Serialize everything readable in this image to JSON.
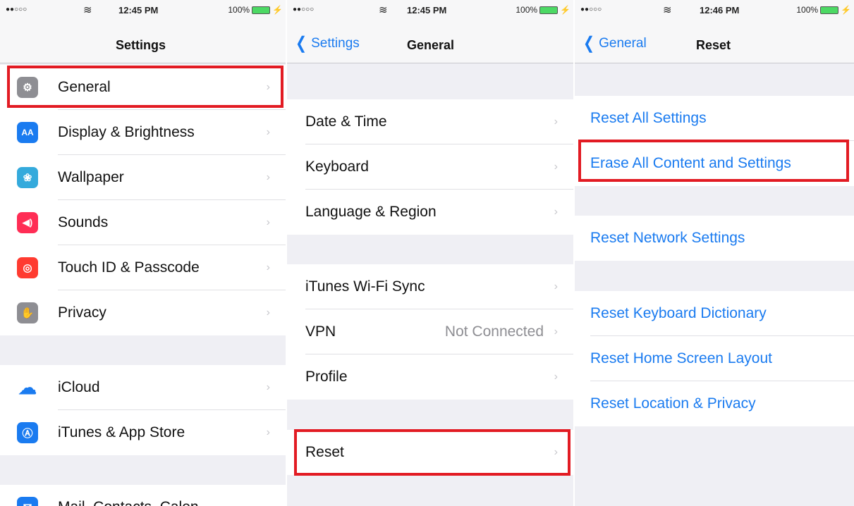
{
  "status_bars": [
    {
      "signal": "●●○○○",
      "time": "12:45 PM",
      "battery": "100%"
    },
    {
      "signal": "●●○○○",
      "time": "12:45 PM",
      "battery": "100%"
    },
    {
      "signal": "●●○○○",
      "time": "12:46 PM",
      "battery": "100%"
    }
  ],
  "settings": {
    "title": "Settings",
    "items": [
      {
        "label": "General",
        "icon": "gear-icon",
        "color": "#8e8e93"
      },
      {
        "label": "Display & Brightness",
        "icon": "display-brightness-icon",
        "color": "#1a7bf0"
      },
      {
        "label": "Wallpaper",
        "icon": "wallpaper-icon",
        "color": "#34aadc"
      },
      {
        "label": "Sounds",
        "icon": "sounds-icon",
        "color": "#ff2d55"
      },
      {
        "label": "Touch ID & Passcode",
        "icon": "fingerprint-icon",
        "color": "#ff3b30"
      },
      {
        "label": "Privacy",
        "icon": "privacy-hand-icon",
        "color": "#8e8e93"
      },
      {
        "label": "iCloud",
        "icon": "icloud-icon",
        "color": "#1a7bf0"
      },
      {
        "label": "iTunes & App Store",
        "icon": "app-store-icon",
        "color": "#1a7bf0"
      },
      {
        "label": "Mail, Contacts, Calen",
        "icon": "mail-icon",
        "color": "#1a7bf0"
      }
    ]
  },
  "general": {
    "back_label": "Settings",
    "title": "General",
    "items": [
      {
        "label": "Date & Time"
      },
      {
        "label": "Keyboard"
      },
      {
        "label": "Language & Region"
      },
      {
        "label": "iTunes Wi-Fi Sync"
      },
      {
        "label": "VPN",
        "value": "Not Connected"
      },
      {
        "label": "Profile"
      },
      {
        "label": "Reset"
      }
    ]
  },
  "reset": {
    "back_label": "General",
    "title": "Reset",
    "items": [
      {
        "label": "Reset All Settings"
      },
      {
        "label": "Erase All Content and Settings"
      },
      {
        "label": "Reset Network Settings"
      },
      {
        "label": "Reset Keyboard Dictionary"
      },
      {
        "label": "Reset Home Screen Layout"
      },
      {
        "label": "Reset Location & Privacy"
      }
    ]
  },
  "highlight_color": "#e21b23",
  "accent_color": "#1a7bf0"
}
